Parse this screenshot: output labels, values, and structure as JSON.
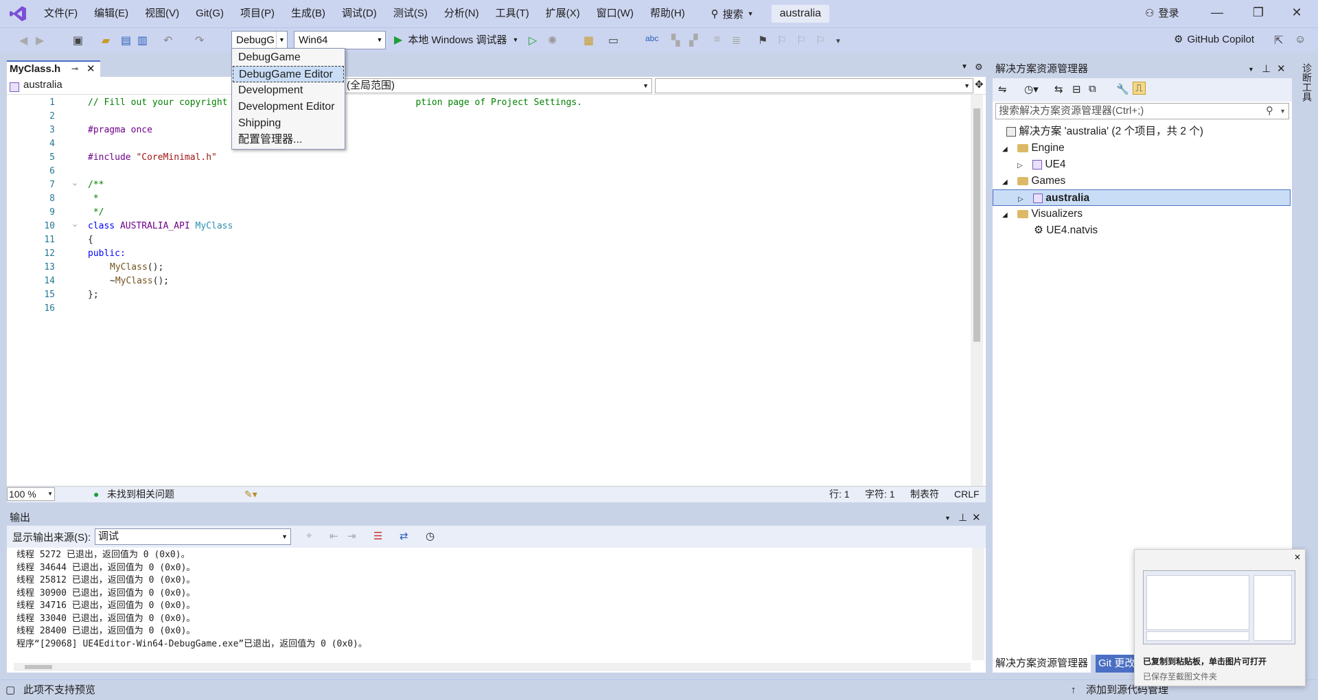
{
  "menu": [
    "文件(F)",
    "编辑(E)",
    "视图(V)",
    "Git(G)",
    "项目(P)",
    "生成(B)",
    "调试(D)",
    "测试(S)",
    "分析(N)",
    "工具(T)",
    "扩展(X)",
    "窗口(W)",
    "帮助(H)"
  ],
  "search_label": "搜索",
  "project_name": "australia",
  "login_label": "登录",
  "toolbar": {
    "config_value": "DebugG",
    "platform_value": "Win64",
    "run_label": "本地 Windows 调试器",
    "copilot_label": "GitHub Copilot"
  },
  "config_options": [
    "DebugGame",
    "DebugGame Editor",
    "Development",
    "Development Editor",
    "Shipping",
    "配置管理器..."
  ],
  "config_selected_index": 1,
  "editor": {
    "tab_title": "MyClass.h",
    "nav_project": "australia",
    "nav_scope": "(全局范围)",
    "lines": [
      "1",
      "2",
      "3",
      "4",
      "5",
      "6",
      "7",
      "8",
      "9",
      "10",
      "11",
      "12",
      "13",
      "14",
      "15",
      "16"
    ],
    "code_line1_a": "// Fill out your copyright",
    "code_line1_b": "ption page of Project Settings.",
    "code_pragma": "#pragma once",
    "code_include_kw": "#include ",
    "code_include_str": "\"CoreMinimal.h\"",
    "code_doc_open": "/**",
    "code_doc_mid": " *",
    "code_doc_close": " */",
    "code_class_kw": "class ",
    "code_class_macro": "AUSTRALIA_API ",
    "code_class_name": "MyClass",
    "code_brace_open": "{",
    "code_public": "public:",
    "code_ctor_name": "MyClass",
    "code_ctor_rest": "();",
    "code_dtor_tilde": "~",
    "code_dtor_name": "MyClass",
    "code_dtor_rest": "();",
    "code_brace_close": "};",
    "zoom": "100 %",
    "issues": "未找到相关问题",
    "pos_line": "行: 1",
    "pos_char": "字符: 1",
    "tab_mode": "制表符",
    "line_ending": "CRLF"
  },
  "output": {
    "title": "输出",
    "source_label": "显示输出来源(S):",
    "source_value": "调试",
    "lines": [
      "线程 5272 已退出，返回值为 0 (0x0)。",
      "线程 34644 已退出，返回值为 0 (0x0)。",
      "线程 25812 已退出，返回值为 0 (0x0)。",
      "线程 30900 已退出，返回值为 0 (0x0)。",
      "线程 34716 已退出，返回值为 0 (0x0)。",
      "线程 33040 已退出，返回值为 0 (0x0)。",
      "线程 28400 已退出，返回值为 0 (0x0)。",
      "程序“[29068] UE4Editor-Win64-DebugGame.exe”已退出，返回值为 0 (0x0)。"
    ]
  },
  "solution": {
    "title": "解决方案资源管理器",
    "search_placeholder": "搜索解决方案资源管理器(Ctrl+;)",
    "root": "解决方案 'australia' (2 个项目，共 2 个)",
    "engine": "Engine",
    "ue4": "UE4",
    "games": "Games",
    "australia": "australia",
    "visualizers": "Visualizers",
    "natvis": "UE4.natvis",
    "bottom_tab1": "解决方案资源管理器",
    "bottom_tab2": "Git 更改"
  },
  "right_strip": "诊断工具",
  "status": {
    "left": "此项不支持预览",
    "right": "添加到源代码管理"
  },
  "toast": {
    "title": "已复制到粘贴板，单击图片可打开",
    "subtitle": "已保存至截图文件夹"
  }
}
